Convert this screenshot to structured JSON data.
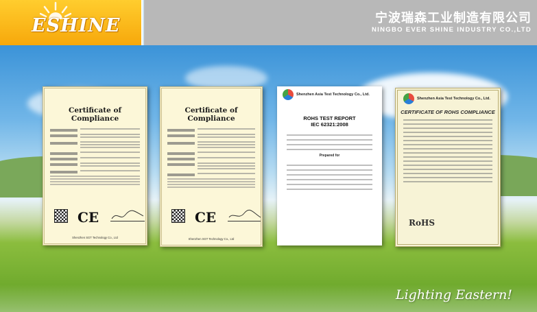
{
  "header": {
    "logo_text": "ESHINE",
    "company_cn": "宁波瑞森工业制造有限公司",
    "company_en": "NINGBO EVER SHINE INDUSTRY CO.,LTD"
  },
  "certificates": [
    {
      "title": "Certificate of Compliance",
      "mark": "CE",
      "footer": "Shenzhen SGT Technology Co., Ltd"
    },
    {
      "title": "Certificate of Compliance",
      "mark": "CE",
      "footer": "Shenzhen SGT Technology Co., Ltd"
    },
    {
      "org": "Shenzhen Asia Test Technology Co., Ltd.",
      "title": "ROHS TEST REPORT",
      "standard": "IEC 62321:2008",
      "prepared": "Prepared for"
    },
    {
      "org": "Shenzhen Asia Test Technology Co., Ltd.",
      "title": "CERTIFICATE OF ROHS COMPLIANCE",
      "mark": "RoHS"
    }
  ],
  "slogan": "Lighting Eastern!",
  "colors": {
    "header_orange": "#f7a80b",
    "header_gray": "#b8b8b8"
  }
}
